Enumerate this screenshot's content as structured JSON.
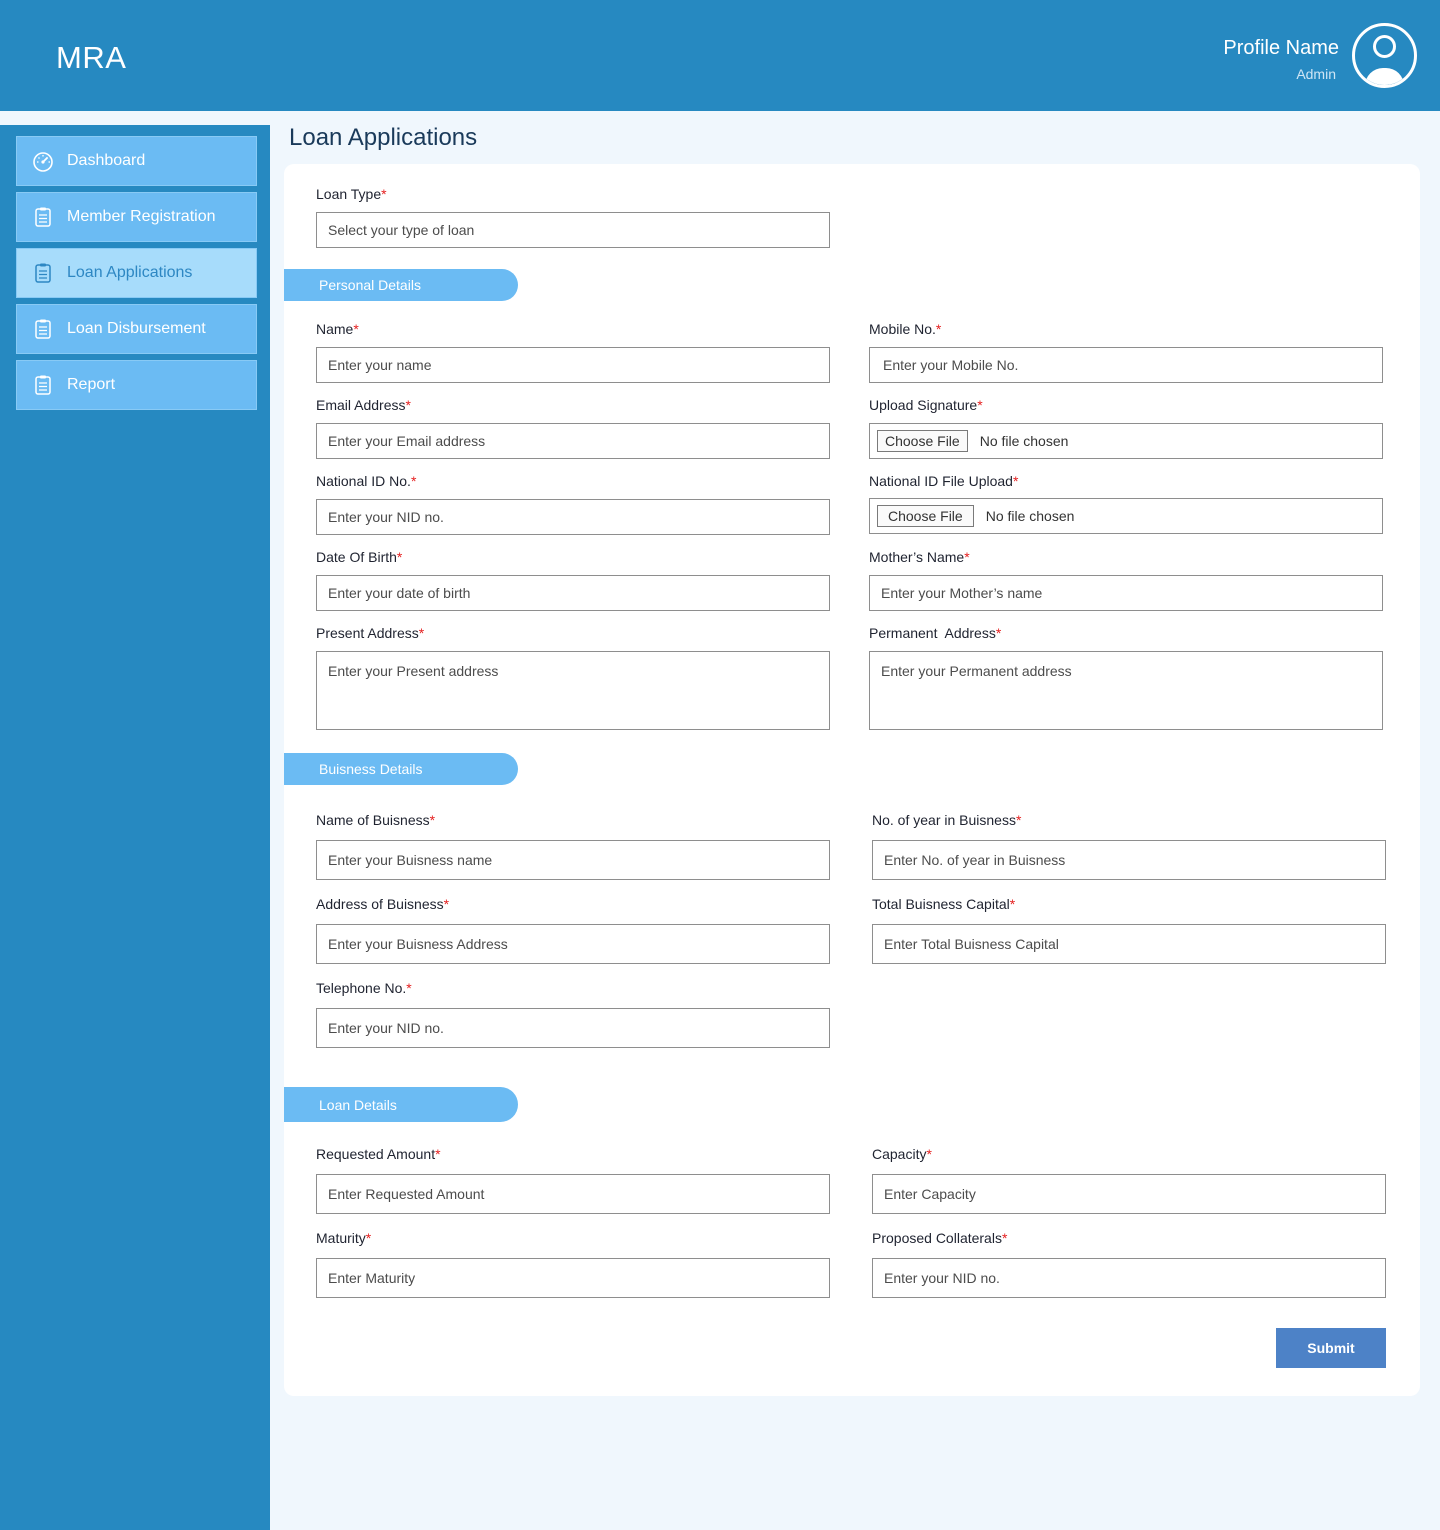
{
  "app": {
    "title": "MRA"
  },
  "profile": {
    "name": "Profile Name",
    "role": "Admin"
  },
  "sidebar": {
    "items": [
      {
        "label": "Dashboard",
        "icon": "dashboard-icon"
      },
      {
        "label": "Member Registration",
        "icon": "clipboard-icon"
      },
      {
        "label": "Loan Applications",
        "icon": "clipboard-icon",
        "active": true
      },
      {
        "label": "Loan Disbursement",
        "icon": "clipboard-icon"
      },
      {
        "label": "Report",
        "icon": "clipboard-icon"
      }
    ]
  },
  "page": {
    "title": "Loan Applications"
  },
  "form": {
    "required_mark": "*",
    "loan_type": {
      "label": "Loan Type",
      "placeholder": "Select your type of loan"
    },
    "personal": {
      "section": "Personal Details",
      "name": {
        "label": "Name",
        "placeholder": "Enter your name"
      },
      "mobile": {
        "label": "Mobile No.",
        "placeholder": "Enter your Mobile No."
      },
      "email": {
        "label": "Email Address",
        "placeholder": "Enter your Email address"
      },
      "signature": {
        "label": "Upload Signature",
        "button": "Choose File",
        "status": "No file chosen"
      },
      "nid": {
        "label": "National ID No.",
        "placeholder": "Enter your NID no."
      },
      "nid_file": {
        "label": "National ID File Upload",
        "button": "Choose File",
        "status": "No file chosen"
      },
      "dob": {
        "label": "Date Of Birth",
        "placeholder": "Enter your date of birth"
      },
      "mother": {
        "label": "Mother’s Name",
        "placeholder": "Enter your Mother’s name"
      },
      "present_address": {
        "label": "Present Address",
        "placeholder": "Enter your Present address"
      },
      "permanent_address": {
        "label": "Permanent  Address",
        "placeholder": "Enter your Permanent address"
      }
    },
    "business": {
      "section": "Buisness Details",
      "name": {
        "label": "Name of Buisness",
        "placeholder": "Enter your Buisness name"
      },
      "years": {
        "label": "No. of year in Buisness",
        "placeholder": "Enter No. of year in Buisness"
      },
      "address": {
        "label": "Address of Buisness",
        "placeholder": "Enter your Buisness Address"
      },
      "capital": {
        "label": "Total Buisness Capital",
        "placeholder": "Enter Total Buisness Capital"
      },
      "telephone": {
        "label": "Telephone No.",
        "placeholder": "Enter your NID no."
      }
    },
    "loan": {
      "section": "Loan Details",
      "amount": {
        "label": "Requested Amount",
        "placeholder": "Enter Requested Amount"
      },
      "capacity": {
        "label": "Capacity",
        "placeholder": "Enter Capacity"
      },
      "maturity": {
        "label": "Maturity",
        "placeholder": "Enter Maturity"
      },
      "collaterals": {
        "label": "Proposed Collaterals",
        "placeholder": "Enter your NID no."
      }
    },
    "submit_label": "Submit"
  },
  "colors": {
    "header": "#2689c1",
    "sidebar_item": "#6bbbf3",
    "sidebar_active": "#a7dcfb",
    "submit": "#4d82c7",
    "required": "#e52020"
  }
}
